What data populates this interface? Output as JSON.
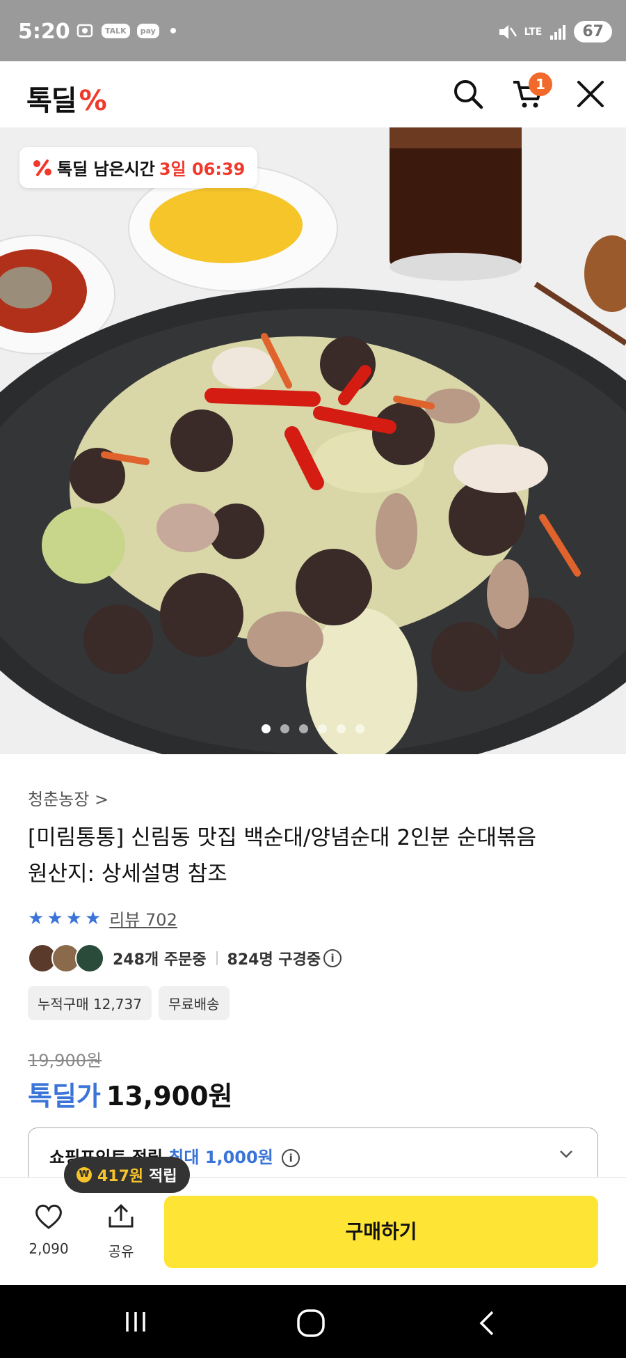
{
  "status": {
    "time": "5:20",
    "battery": "67",
    "talk": "TALK",
    "pay": "pay",
    "network": "LTE"
  },
  "header": {
    "logo_text": "톡딜",
    "logo_symbol": "%",
    "cart_count": "1",
    "icons": [
      "search-icon",
      "cart-icon",
      "close-icon"
    ]
  },
  "hero": {
    "timer_label": "톡딜 남은시간",
    "timer_value": "3일 06:39",
    "slide_count": 6,
    "active_slide": 1
  },
  "product": {
    "store": "청춘농장 >",
    "title_line1": "[미림통통] 신림동 맛집 백순대/양념순대 2인분 순대볶음",
    "title_line2": "원산지: 상세설명 참조",
    "rating_stars": 4,
    "review_label": "리뷰 702",
    "ordering": "248개 주문중",
    "watching": "824명 구경중",
    "tags": [
      "누적구매 12,737",
      "무료배송"
    ],
    "original_price": "19,900원",
    "deal_label": "톡딜가",
    "deal_price": "13,900원",
    "coupon_text_prefix": "쇼핑포인트 적립",
    "coupon_text_highlight": "최대 1,000원"
  },
  "bottom_bar": {
    "reward_amount": "417원",
    "reward_suffix": "적립",
    "like_count": "2,090",
    "share_label": "공유",
    "buy_label": "구매하기"
  },
  "colors": {
    "accent_blue": "#3a74d8",
    "buy_yellow": "#fde435",
    "logo_red": "#f0392b",
    "badge_orange": "#f26a2b"
  }
}
